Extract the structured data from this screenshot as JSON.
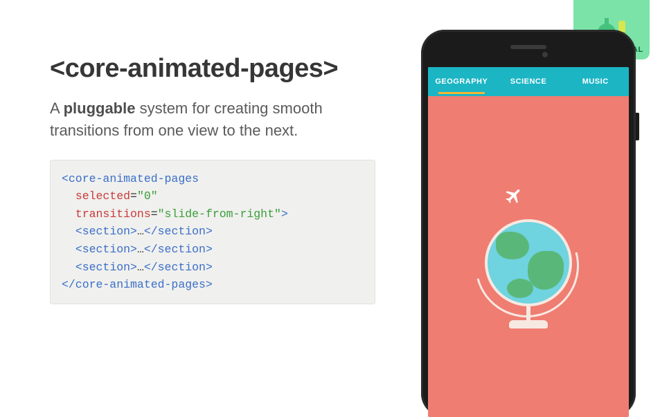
{
  "badge": {
    "label": "EXPERIMENTAL"
  },
  "title": "<core-animated-pages>",
  "description": {
    "pre": "A ",
    "bold": "pluggable",
    "post": " system for creating smooth transitions from one view to the next."
  },
  "code": {
    "open_tag": "core-animated-pages",
    "attr1_name": "selected",
    "attr1_value": "\"0\"",
    "attr2_name": "transitions",
    "attr2_value": "\"slide-from-right\"",
    "section_open": "<section>",
    "ellipsis": "…",
    "section_close": "</section>",
    "close_tag": "</core-animated-pages>"
  },
  "phone": {
    "tabs": [
      {
        "label": "GEOGRAPHY",
        "active": true
      },
      {
        "label": "SCIENCE",
        "active": false
      },
      {
        "label": "MUSIC",
        "active": false
      }
    ]
  }
}
